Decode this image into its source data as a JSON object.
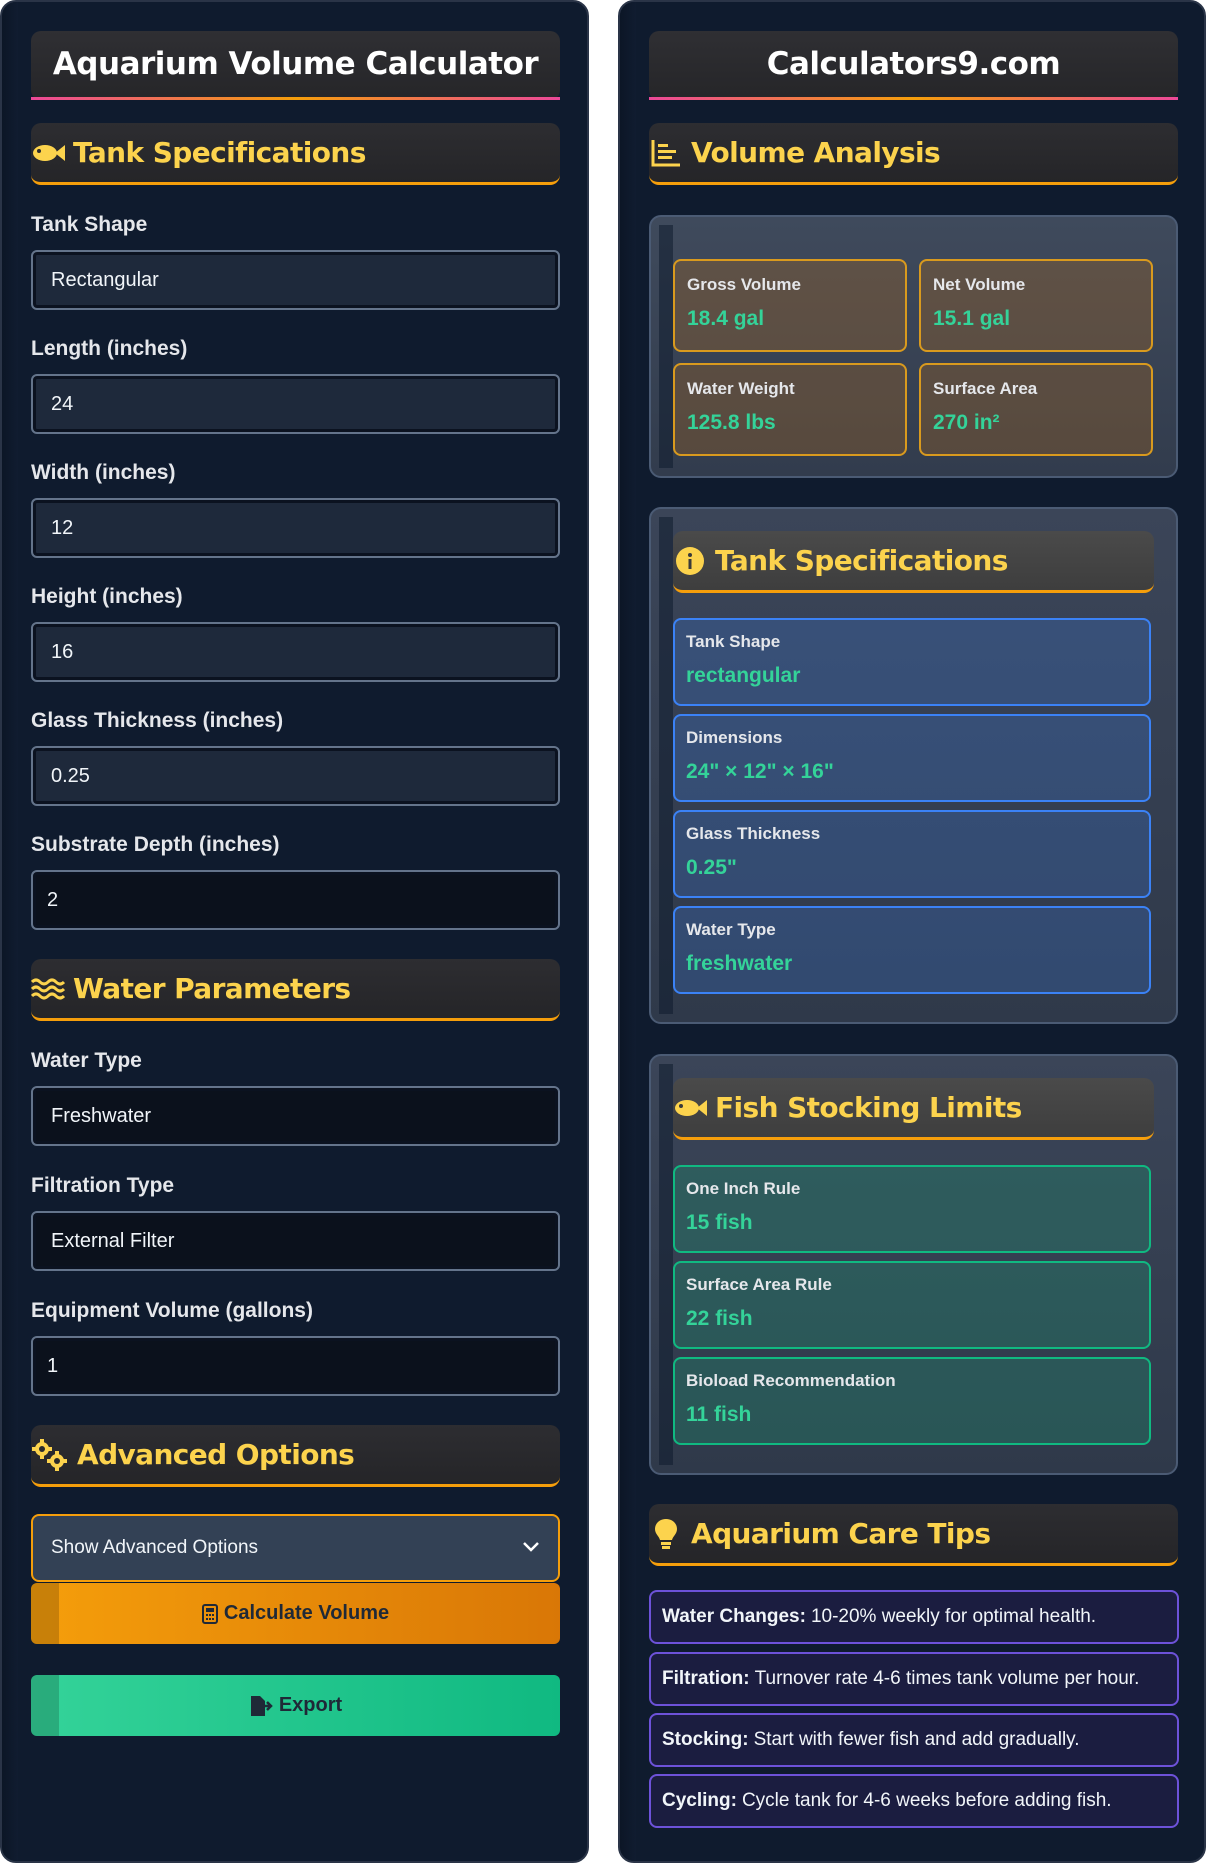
{
  "left": {
    "title": "Aquarium Volume Calculator",
    "tank_section": "Tank Specifications",
    "fields": [
      {
        "label": "Tank Shape",
        "value": "Rectangular"
      },
      {
        "label": "Length (inches)",
        "value": "24"
      },
      {
        "label": "Width (inches)",
        "value": "12"
      },
      {
        "label": "Height (inches)",
        "value": "16"
      },
      {
        "label": "Glass Thickness (inches)",
        "value": "0.25"
      },
      {
        "label": "Substrate Depth (inches)",
        "value": "2"
      }
    ],
    "water_section": "Water Parameters",
    "water_fields": [
      {
        "label": "Water Type",
        "value": "Freshwater"
      },
      {
        "label": "Filtration Type",
        "value": "External Filter"
      },
      {
        "label": "Equipment Volume (gallons)",
        "value": "1"
      }
    ],
    "advanced_section": "Advanced Options",
    "advanced_select": "Show Advanced Options",
    "calc_button": "Calculate Volume",
    "export_button": "Export"
  },
  "right": {
    "title": "Calculators9.com",
    "volume_section": "Volume Analysis",
    "stats": [
      {
        "label": "Gross Volume",
        "value": "18.4 gal"
      },
      {
        "label": "Net Volume",
        "value": "15.1 gal"
      },
      {
        "label": "Water Weight",
        "value": "125.8 lbs"
      },
      {
        "label": "Surface Area",
        "value": "270 in²"
      }
    ],
    "specs_section": "Tank Specifications",
    "specs": [
      {
        "label": "Tank Shape",
        "value": "rectangular"
      },
      {
        "label": "Dimensions",
        "value": "24\" × 12\" × 16\""
      },
      {
        "label": "Glass Thickness",
        "value": "0.25\""
      },
      {
        "label": "Water Type",
        "value": "freshwater"
      }
    ],
    "stocking_section": "Fish Stocking Limits",
    "stocking": [
      {
        "label": "One Inch Rule",
        "value": "15 fish"
      },
      {
        "label": "Surface Area Rule",
        "value": "22 fish"
      },
      {
        "label": "Bioload Recommendation",
        "value": "11 fish"
      }
    ],
    "tips_section": "Aquarium Care Tips",
    "tips": [
      {
        "title": "Water Changes:",
        "text": "10-20% weekly for optimal health."
      },
      {
        "title": "Filtration:",
        "text": "Turnover rate 4-6 times tank volume per hour."
      },
      {
        "title": "Stocking:",
        "text": "Start with fewer fish and add gradually."
      },
      {
        "title": "Cycling:",
        "text": "Cycle tank for 4-6 weeks before adding fish."
      }
    ]
  },
  "colors": {
    "panel_bg": "#0f1b2e",
    "accent_amber": "#f59e0b",
    "heading_yellow": "#fcd34d",
    "value_green": "#34d399",
    "export_green": "#10b981",
    "tip_border": "#6d52d9"
  },
  "icons": {
    "tank": "fish-icon",
    "volume": "chart-bars-icon",
    "water": "water-waves-icon",
    "advanced": "gears-icon",
    "calculate": "calculator-icon",
    "export": "file-export-icon",
    "specs": "info-circle-icon",
    "stocking": "fish-icon",
    "tips": "lightbulb-icon",
    "select": "chevron-down-icon"
  }
}
